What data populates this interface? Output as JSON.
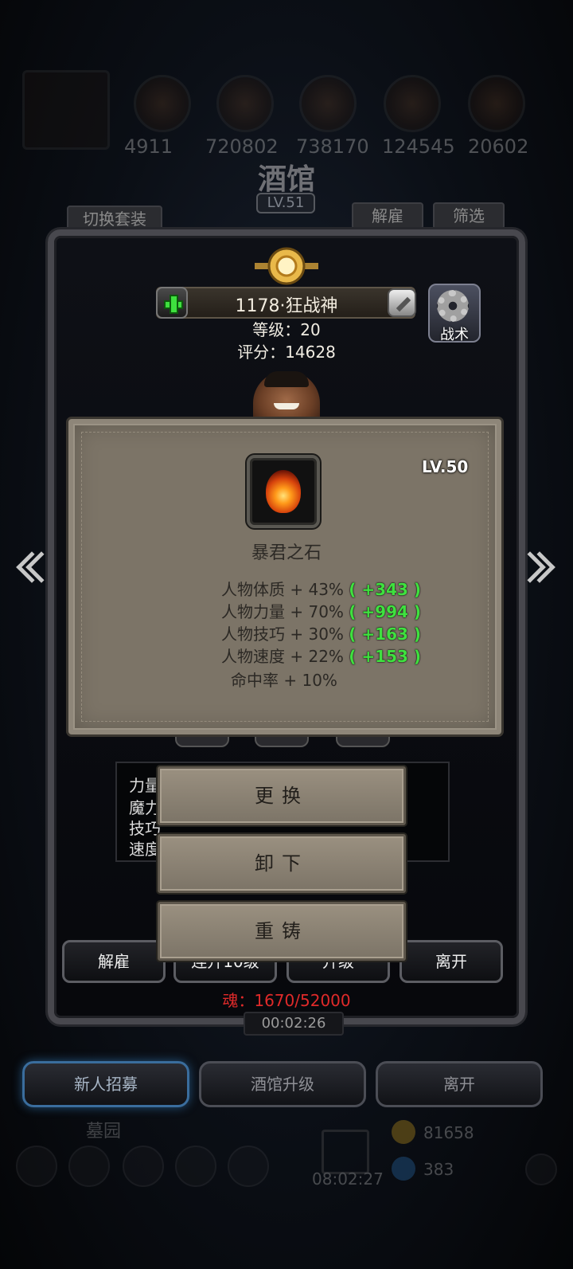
{
  "top_resources": [
    "4911",
    "720802",
    "738170",
    "124545",
    "20602"
  ],
  "tavern": {
    "title": "酒馆",
    "level": "LV.51"
  },
  "header_buttons": {
    "switch_set": "切换套装",
    "dismiss": "解雇",
    "filter": "筛选"
  },
  "hero": {
    "name": "1178·狂战神",
    "level_text": "等级：20",
    "score_text": "评分：14628",
    "tactics_label": "战术"
  },
  "item": {
    "level": "LV.50",
    "name": "暴君之石",
    "attributes": [
      {
        "text": "人物体质 + 43%",
        "bonus": "( +343 )"
      },
      {
        "text": "人物力量 + 70%",
        "bonus": "( +994 )"
      },
      {
        "text": "人物技巧 + 30%",
        "bonus": "( +163 )"
      },
      {
        "text": "人物速度 + 22%",
        "bonus": "( +153 )"
      },
      {
        "text": "命中率 + 10%",
        "bonus": ""
      }
    ]
  },
  "stats_box": {
    "labels": [
      "力量",
      "魔力",
      "技巧",
      "速度"
    ]
  },
  "menu": {
    "replace": "更换",
    "unequip": "卸下",
    "reforge": "重铸"
  },
  "bottom_buttons": {
    "dismiss": "解雇",
    "upgrade10": "连升10级",
    "upgrade": "升级",
    "leave": "离开"
  },
  "soul": "魂：1670/52000",
  "timer": "00:02:26",
  "tabs": {
    "recruit": "新人招募",
    "tavern_upgrade": "酒馆升级",
    "leave": "离开"
  },
  "dock": {
    "cemetery": "墓园",
    "gold": "81658",
    "gems": "383",
    "timer": "08:02:27"
  },
  "colors": {
    "bonus_green": "#3fe13f",
    "soul_red": "#e02a2a",
    "panel": "#7c7467"
  }
}
